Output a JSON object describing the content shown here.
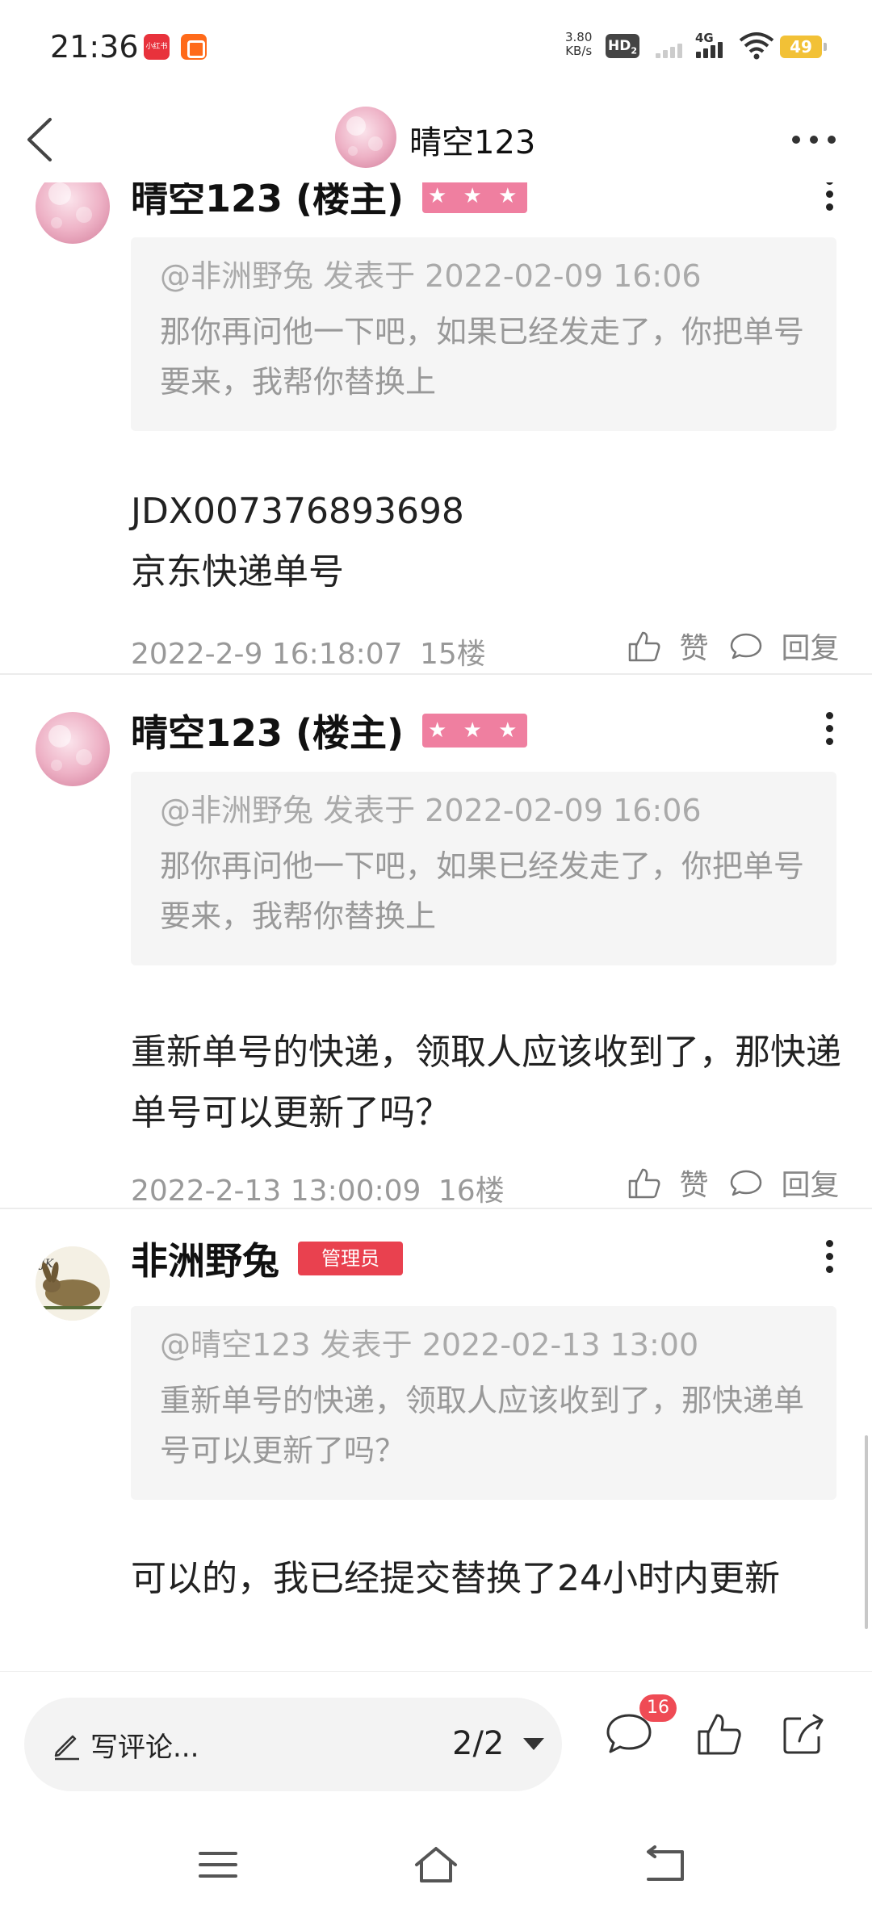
{
  "status_bar": {
    "time": "21:36",
    "app_icon_1": "小红书",
    "network_speed_value": "3.80",
    "network_speed_unit": "KB/s",
    "hd_label": "HD",
    "hd_sub": "2",
    "network_type": "4G",
    "battery": "49"
  },
  "header": {
    "title": "晴空123",
    "back_icon": "chevron-left-icon",
    "more_icon": "more-horizontal-icon"
  },
  "posts": [
    {
      "author": "晴空123 (楼主)",
      "badge": "★ ★ ★",
      "quote_head": "@非洲野兔 发表于 2022-02-09 16:06",
      "quote_body": "那你再问他一下吧，如果已经发走了，你把单号要来，我帮你替换上",
      "body_line1": "JDX007376893698",
      "body_line2": "京东快递单号",
      "time": "2022-2-9 16:18:07",
      "floor": "15楼",
      "like_label": "赞",
      "reply_label": "回复"
    },
    {
      "author": "晴空123 (楼主)",
      "badge": "★ ★ ★",
      "quote_head": "@非洲野兔 发表于 2022-02-09 16:06",
      "quote_body": "那你再问他一下吧，如果已经发走了，你把单号要来，我帮你替换上",
      "body": "重新单号的快递，领取人应该收到了，那快递单号可以更新了吗？",
      "time": "2022-2-13 13:00:09",
      "floor": "16楼",
      "like_label": "赞",
      "reply_label": "回复"
    },
    {
      "author": "非洲野兔",
      "badge": "管理员",
      "quote_head": "@晴空123 发表于 2022-02-13 13:00",
      "quote_body": "重新单号的快递，领取人应该收到了，那快递单号可以更新了吗？",
      "body": "可以的，我已经提交替换了24小时内更新"
    }
  ],
  "bottom_bar": {
    "comment_placeholder": "写评论...",
    "page_indicator": "2/2",
    "comment_count": "16",
    "icons": [
      "pencil-icon",
      "comment-icon",
      "like-icon",
      "share-icon"
    ]
  },
  "system_nav": {
    "icons": [
      "menu-icon",
      "home-icon",
      "back-icon"
    ]
  },
  "colors": {
    "badge_pink": "#ef7fa0",
    "badge_red": "#e9414f",
    "quote_bg": "#f5f5f5",
    "count_badge": "#ef4b55"
  }
}
